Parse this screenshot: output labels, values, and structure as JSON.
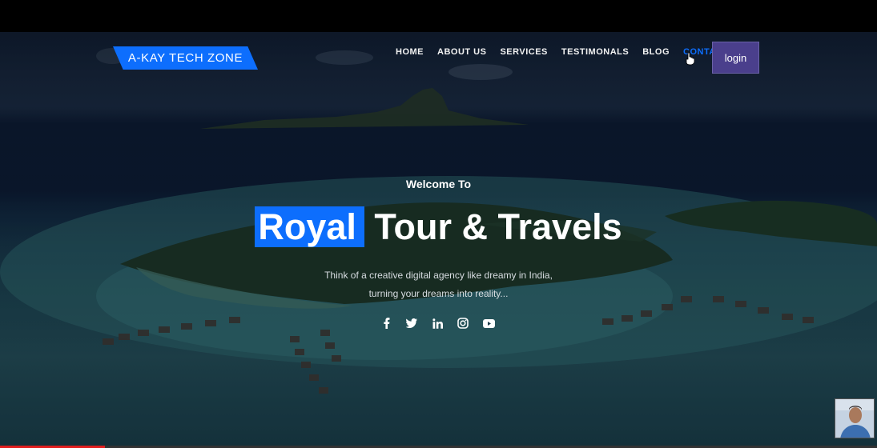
{
  "brand": {
    "name": "A-KAY TECH ZONE"
  },
  "nav": {
    "items": [
      "HOME",
      "ABOUT US",
      "SERVICES",
      "TESTIMONALS",
      "BLOG",
      "CONTACT"
    ],
    "active": "CONTACT",
    "login_label": "login"
  },
  "hero": {
    "welcome": "Welcome To",
    "title_highlight": "Royal",
    "title_rest": " Tour & Travels",
    "desc_line1": "Think of a creative digital agency like dreamy in India,",
    "desc_line2": "turning your dreams into reality..."
  },
  "socials": [
    "facebook-icon",
    "twitter-icon",
    "linkedin-icon",
    "instagram-icon",
    "youtube-icon"
  ],
  "colors": {
    "accent": "#0d6efd",
    "login_bg": "#4a3f8c",
    "progress": "#e01e1e"
  },
  "video_progress": 0.12
}
